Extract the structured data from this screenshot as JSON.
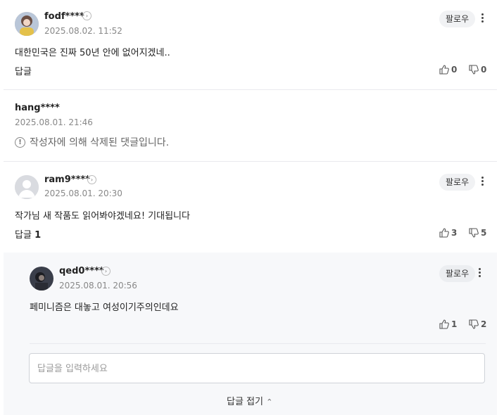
{
  "comments": [
    {
      "name": "fodf****",
      "date": "2025.08.02. 11:52",
      "follow": "팔로우",
      "text": "대한민국은 진짜 50년 안에 없어지겠네..",
      "reply_label": "답글",
      "reply_count": "",
      "up": "0",
      "down": "0"
    },
    {
      "name": "hang****",
      "date": "2025.08.01. 21:46",
      "deleted_text": "작성자에 의해 삭제된 댓글입니다."
    },
    {
      "name": "ram9****",
      "date": "2025.08.01. 20:30",
      "follow": "팔로우",
      "text": "작가님 새 작품도 읽어봐야겠네요! 기대됩니다",
      "reply_label": "답글",
      "reply_count": "1",
      "up": "3",
      "down": "5"
    }
  ],
  "reply": {
    "name": "qed0****",
    "date": "2025.08.01. 20:56",
    "follow": "팔로우",
    "text": "페미니즘은 대놓고 여성이기주의인데요",
    "up": "1",
    "down": "2"
  },
  "reply_input": {
    "placeholder": "답글을 입력하세요"
  },
  "collapse_label": "답글 접기"
}
